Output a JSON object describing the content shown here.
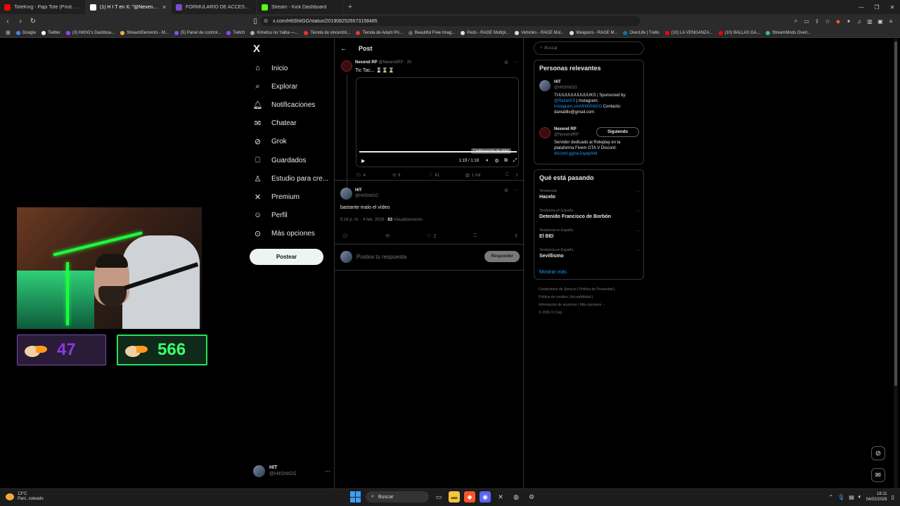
{
  "browser": {
    "tabs": [
      {
        "label": "ToteKing - Papi Tote (Prod. 808 Biano",
        "color": "#ff0000",
        "active": false
      },
      {
        "label": "(1) H I T en X: \"@NexendRP bas",
        "color": "#ffffff",
        "active": true
      },
      {
        "label": "FORMULARIO DE ACCESO A EQUIPO",
        "color": "#7b4bd0",
        "active": false
      },
      {
        "label": "Stream - Kick Dashboard",
        "color": "#53fc18",
        "active": false
      }
    ],
    "url": "x.com/HitShitGG/status/2019082526573158485",
    "bookmarks": [
      "Google",
      "Twitter",
      "(3) HitGG's Dashboa...",
      "StreamElements - M...",
      "(5) Panel de control...",
      "Twitch",
      "Kimetsu no Yaiba —...",
      "Tienda de vincentrii...",
      "Tienda de Adam Pri...",
      "Beautiful Free Imag...",
      "Peds - RAGE Multipl...",
      "Vehicles - RAGE Mul...",
      "Weapons - RAGE M...",
      "OverLife | Trello",
      "(10) LA VENGANZA...",
      "(10) BALLAS GA...",
      "StreamMods Overl..."
    ]
  },
  "overlay": {
    "counter1": "47",
    "counter2": "566",
    "counter1_color": "#8a39e0",
    "counter2_color": "#3bff6d"
  },
  "nav": {
    "logo": "X",
    "items": [
      {
        "label": "Inicio",
        "icon": "home-icon"
      },
      {
        "label": "Explorar",
        "icon": "search-icon"
      },
      {
        "label": "Notificaciones",
        "icon": "bell-icon"
      },
      {
        "label": "Chatear",
        "icon": "mail-icon"
      },
      {
        "label": "Grok",
        "icon": "grok-icon"
      },
      {
        "label": "Guardados",
        "icon": "bookmark-icon"
      },
      {
        "label": "Estudio para cre...",
        "icon": "studio-icon"
      },
      {
        "label": "Premium",
        "icon": "x-icon"
      },
      {
        "label": "Perfil",
        "icon": "user-icon"
      },
      {
        "label": "Más opciones",
        "icon": "more-icon"
      }
    ],
    "post_button": "Postear",
    "account_name": "HIT",
    "account_handle": "@HitShitGG"
  },
  "main": {
    "title": "Post",
    "quoted": {
      "name": "Nexend RP",
      "handle": "@NexendRP · 2h",
      "text": "Tic Tac... ⌛⌛⌛",
      "video_time": "1:19 / 1:19",
      "tooltip": "Configuración de vídeo",
      "replies": "4",
      "reposts": "9",
      "likes": "41",
      "views": "1 mil"
    },
    "reply": {
      "name": "HIT",
      "handle": "@HitShitGG",
      "text": "bastante malo el vídeo",
      "meta": "5:16 p. m. · 4 feb. 2026 · ",
      "views_count": "83",
      "views_label": " Visualizaciones",
      "likes": "2"
    },
    "compose_placeholder": "Postea tu respuesta",
    "reply_button": "Responder"
  },
  "right": {
    "search_placeholder": "Buscar",
    "relevant_title": "Personas relevantes",
    "people": [
      {
        "name": "HIT",
        "handle": "@HitShitGG",
        "bio_pre": "TUUUUUUUUUUUKS | Sponsored by: ",
        "bio_link1": "@RazerES",
        "bio_mid": " | Instagram: ",
        "bio_link2": "instagram.com/HitShitGG",
        "bio_post": " Contacto: daniatillo@gmail.com"
      },
      {
        "name": "Nexend RP",
        "handle": "@NexendRP",
        "bio_pre": "Servidor dedicado al Roleplay en la plataforma Fivem GTA V Discord: ",
        "bio_link1": "discord.gg/seJuyapmet",
        "follow": "Siguiendo"
      }
    ],
    "trends_title": "Qué está pasando",
    "trends": [
      {
        "cat": "Tendencias",
        "name": "Hacelo"
      },
      {
        "cat": "Tendencia en España",
        "name": "Detenido Francisco de Borbón"
      },
      {
        "cat": "Tendencia en España",
        "name": "El BEI"
      },
      {
        "cat": "Tendencia en España",
        "name": "Sevillismo"
      }
    ],
    "show_more": "Mostrar más",
    "footer": [
      "Condiciones de Servicio",
      "Política de Privacidad",
      "Política de cookies",
      "Accesibilidad",
      "Información de anuncios",
      "Más opciones ···",
      "© 2026 X Corp."
    ]
  },
  "taskbar": {
    "temp": "13°C",
    "weather": "Parc. soleado",
    "search": "Buscar",
    "time": "18:11",
    "date": "04/02/2026"
  }
}
